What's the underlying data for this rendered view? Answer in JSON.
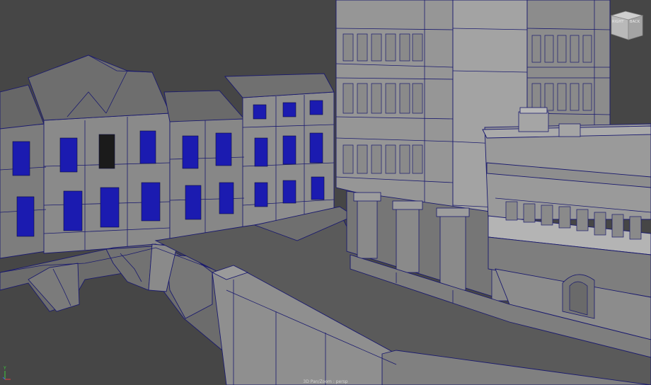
{
  "viewport": {
    "camera_label": "3D Pan/Zoom : persp",
    "background": "#444444",
    "wire_color": "#1a1a6e",
    "window_color": "#1b1bb0"
  },
  "viewcube": {
    "front_label": "RIGHT",
    "side_label": "BACK"
  },
  "axis": {
    "up": "Y"
  }
}
